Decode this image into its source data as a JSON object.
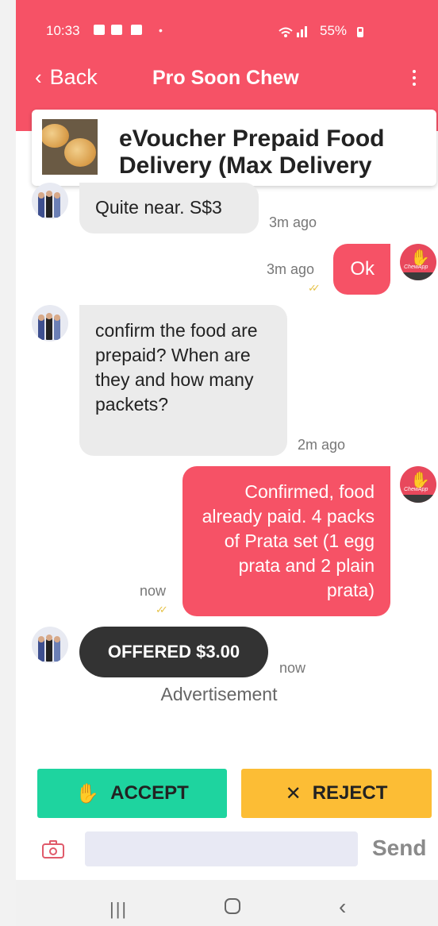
{
  "status_bar": {
    "time": "10:33",
    "notification_dot": "•",
    "battery": "55%"
  },
  "header": {
    "back_label": "Back",
    "back_chevron": "‹",
    "title": "Pro Soon Chew"
  },
  "product": {
    "title": "eVoucher Prepaid Food Delivery (Max Delivery"
  },
  "messages": [
    {
      "from": "other",
      "text": "Quite near. S$3",
      "time": "3m ago"
    },
    {
      "from": "me",
      "text": "Ok",
      "time": "3m ago",
      "ticks": "✓✓"
    },
    {
      "from": "other",
      "text": "confirm the food are prepaid? When are they and how many packets?",
      "time": "2m ago"
    },
    {
      "from": "me",
      "text": "Confirmed, food already paid. 4 packs of Prata set (1 egg prata and 2 plain prata)",
      "time": "now",
      "ticks": "✓✓"
    }
  ],
  "offer": {
    "label": "OFFERED $3.00",
    "time": "now"
  },
  "advertisement": "Advertisement",
  "actions": {
    "accept_label": "ACCEPT",
    "reject_label": "REJECT",
    "accept_icon": "hand-icon",
    "reject_icon": "close-icon"
  },
  "composer": {
    "placeholder": "",
    "send_label": "Send"
  },
  "avatar_label": "ChewApp",
  "colors": {
    "primary": "#f65266",
    "accept": "#1ed49f",
    "reject": "#fcbd35",
    "offer_bg": "#333333",
    "incoming_bubble": "#ebebeb"
  }
}
